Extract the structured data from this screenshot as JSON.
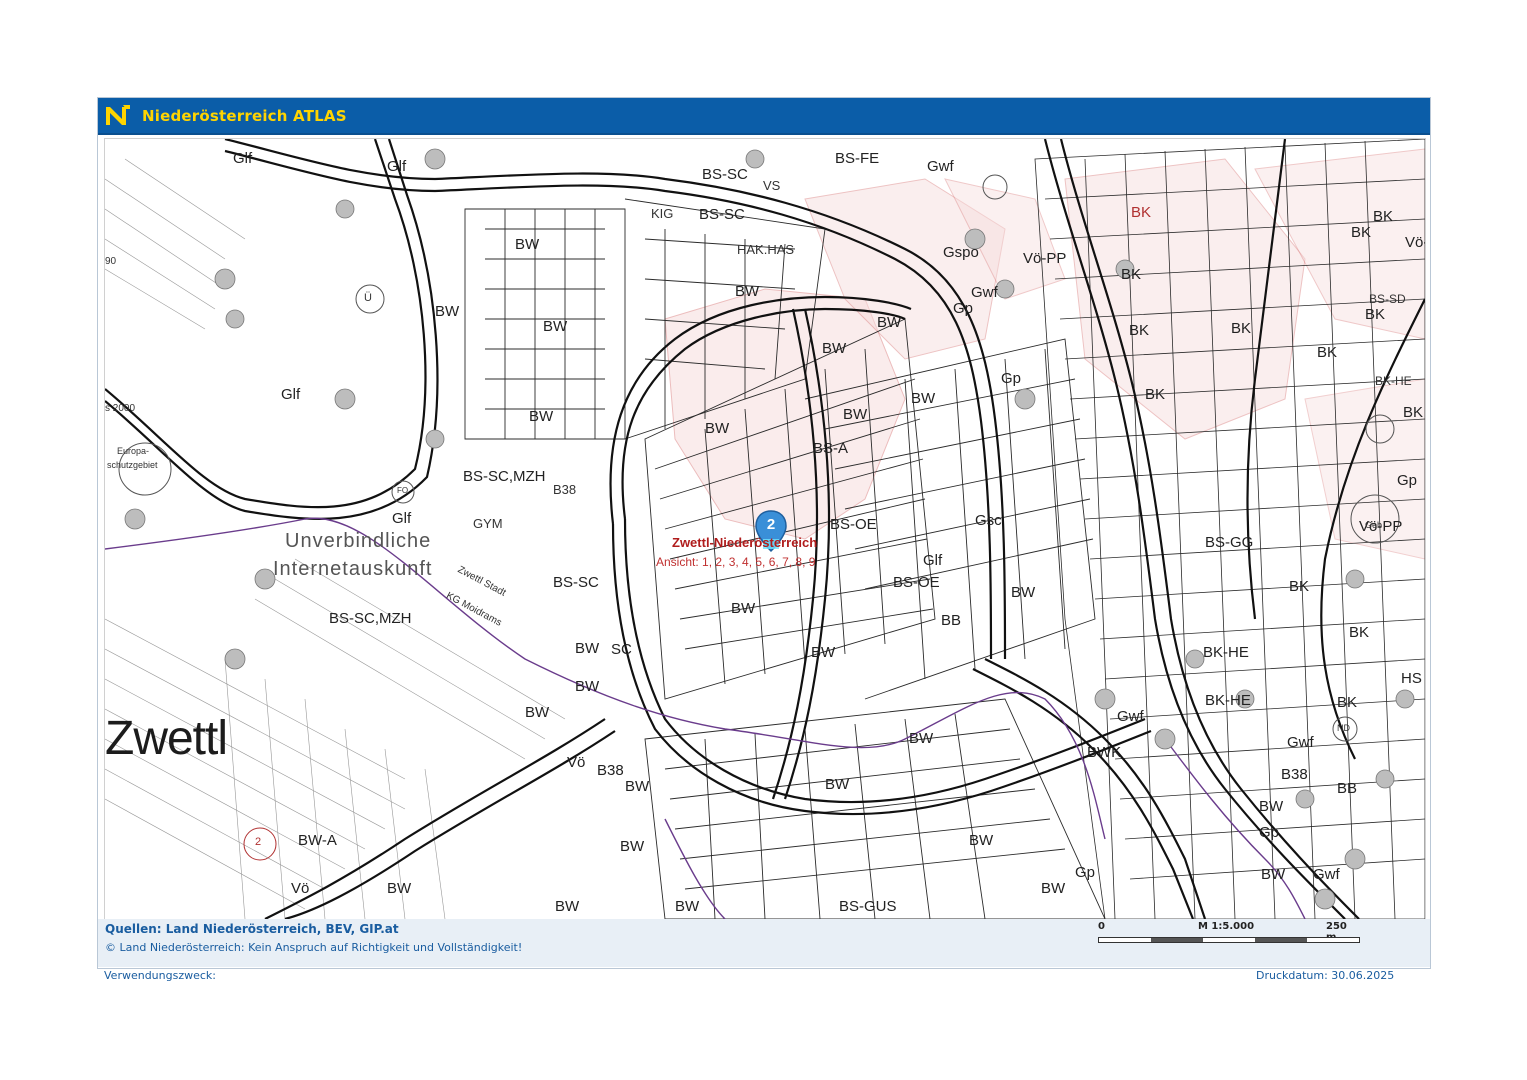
{
  "header": {
    "app_title": "Niederösterreich ATLAS",
    "brand_color": "#0b5da8",
    "title_color": "#ffd400",
    "logo_icon": "noe-logo-icon"
  },
  "map": {
    "town_name": "Zwettl",
    "watermark_line1": "Unverbindliche",
    "watermark_line2": "Internetauskunft",
    "municipality_line1": "Zwettl Stadt",
    "municipality_line2": "KG Moidrams",
    "marker": {
      "count": "2",
      "place_title": "Zwettl-Niederösterreich",
      "views_text": "Ansicht: 1, 2, 3, 4, 5, 6, 7, 8, 9",
      "color": "#3a8fd8"
    },
    "zone_labels": [
      {
        "text": "Glf"
      },
      {
        "text": "Glf"
      },
      {
        "text": "Glf"
      },
      {
        "text": "Glf"
      },
      {
        "text": "BS-SC"
      },
      {
        "text": "BS-FE"
      },
      {
        "text": "BS-SC"
      },
      {
        "text": "HAK.HAS"
      },
      {
        "text": "BW"
      },
      {
        "text": "BW"
      },
      {
        "text": "BW"
      },
      {
        "text": "BW"
      },
      {
        "text": "BW"
      },
      {
        "text": "BW"
      },
      {
        "text": "BW"
      },
      {
        "text": "BW"
      },
      {
        "text": "BW"
      },
      {
        "text": "BW"
      },
      {
        "text": "BS-SC,MZH"
      },
      {
        "text": "B38"
      },
      {
        "text": "GYM"
      },
      {
        "text": "BS-SC"
      },
      {
        "text": "BS-SC,MZH"
      },
      {
        "text": "BW"
      },
      {
        "text": "SC"
      },
      {
        "text": "BW"
      },
      {
        "text": "BW"
      },
      {
        "text": "Vö"
      },
      {
        "text": "B38"
      },
      {
        "text": "BW-A"
      },
      {
        "text": "BW"
      },
      {
        "text": "Vö"
      },
      {
        "text": "BW"
      },
      {
        "text": "BW"
      },
      {
        "text": "BW"
      },
      {
        "text": "BS-OE"
      },
      {
        "text": "BS-OE"
      },
      {
        "text": "BS-A"
      },
      {
        "text": "BW"
      },
      {
        "text": "BW"
      },
      {
        "text": "Gwf"
      },
      {
        "text": "Gspo"
      },
      {
        "text": "Vö-PP"
      },
      {
        "text": "Gwf"
      },
      {
        "text": "Gp"
      },
      {
        "text": "Gp"
      },
      {
        "text": "BK"
      },
      {
        "text": "BK"
      },
      {
        "text": "BK"
      },
      {
        "text": "BK"
      },
      {
        "text": "BK"
      },
      {
        "text": "BK"
      },
      {
        "text": "BK"
      },
      {
        "text": "BK-HE"
      },
      {
        "text": "BK"
      },
      {
        "text": "Gp"
      },
      {
        "text": "Vö-PP"
      },
      {
        "text": "BS-GG"
      },
      {
        "text": "BK"
      },
      {
        "text": "BK-HE"
      },
      {
        "text": "Gwf"
      },
      {
        "text": "B38"
      },
      {
        "text": "BW"
      },
      {
        "text": "Gp"
      },
      {
        "text": "BB"
      },
      {
        "text": "Gwf"
      },
      {
        "text": "BW"
      },
      {
        "text": "Gp"
      },
      {
        "text": "BS-GUS"
      },
      {
        "text": "BW"
      },
      {
        "text": "BW"
      },
      {
        "text": "BW"
      },
      {
        "text": "BW"
      },
      {
        "text": "BW"
      },
      {
        "text": "Gsc"
      },
      {
        "text": "Glf"
      },
      {
        "text": "BB"
      },
      {
        "text": "BW"
      },
      {
        "text": "Gwf"
      },
      {
        "text": "BWK"
      },
      {
        "text": "BK"
      },
      {
        "text": "BK-HE"
      },
      {
        "text": "BK"
      },
      {
        "text": "HS"
      },
      {
        "text": "BS-SD"
      },
      {
        "text": "BK"
      },
      {
        "text": "Vö-PP"
      },
      {
        "text": "BW"
      },
      {
        "text": "BK"
      }
    ],
    "edge_labels": {
      "left_scale_text": "s 2000",
      "europa": "Europa-",
      "schutzgebiet": "schutzgebiet",
      "left_90": "90"
    },
    "symbol_labels": {
      "u_symbol": "Ü",
      "fo_symbol": "FO",
      "circle_2": "2",
      "geb": "Geb",
      "nd": "ND",
      "vs": "VS",
      "kig": "KIG"
    }
  },
  "footer": {
    "sources": "Quellen: Land Niederösterreich, BEV, GIP.at",
    "disclaimer": "© Land Niederösterreich: Kein Anspruch auf Richtigkeit und Vollständigkeit!",
    "scale_start": "0",
    "scale_ratio": "M 1:5.000",
    "scale_end": "250 m",
    "purpose": "Verwendungszweck:",
    "print_date": "Druckdatum: 30.06.2025"
  }
}
